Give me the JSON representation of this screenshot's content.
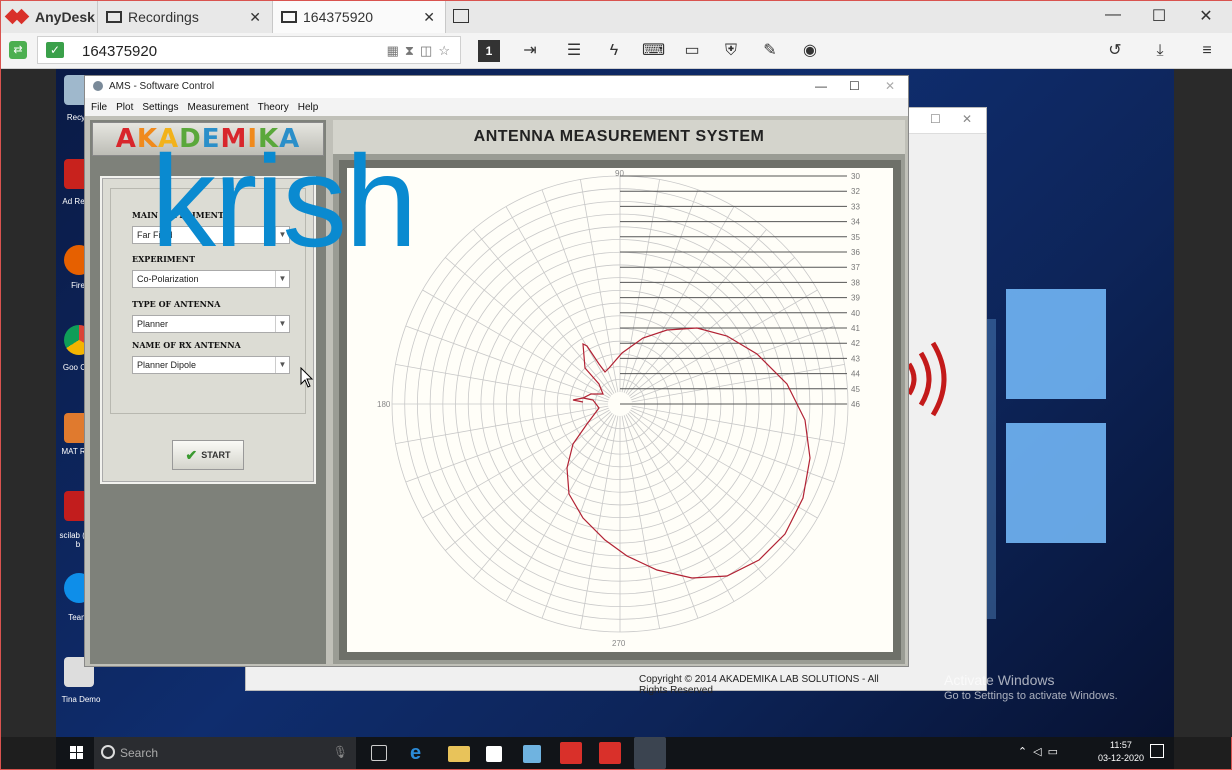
{
  "anydesk": {
    "brand": "AnyDesk",
    "tabs": [
      {
        "label": "Recordings"
      },
      {
        "label": "164375920"
      }
    ],
    "tab_close": "✕",
    "window_controls": {
      "minimize": "—",
      "maximize": "☐",
      "close": "✕"
    },
    "address": "164375920"
  },
  "ams": {
    "title": "AMS - Software Control",
    "title_controls": {
      "minimize": "—",
      "maximize": "☐",
      "close": "✕"
    },
    "menu": [
      "File",
      "Plot",
      "Settings",
      "Measurement",
      "Theory",
      "Help"
    ],
    "logo": "AKADEMIKA",
    "header": "ANTENNA MEASUREMENT SYSTEM",
    "fields": [
      {
        "label": "MAIN EXPERIMENT",
        "value": "Far Field"
      },
      {
        "label": "EXPERIMENT",
        "value": "Co-Polarization"
      },
      {
        "label": "TYPE OF ANTENNA",
        "value": "Planner"
      },
      {
        "label": "NAME OF RX ANTENNA",
        "value": "Planner Dipole"
      }
    ],
    "start_label": "START",
    "copyright": "Copyright © 2014 AKADEMIKA LAB SOLUTIONS - All Rights Reserved"
  },
  "polar_plot": {
    "angle_labels": {
      "top": "90",
      "left": "180",
      "bottom": "270"
    },
    "rings": [
      30,
      32,
      33,
      34,
      35,
      36,
      37,
      38,
      39,
      40,
      41,
      42,
      43,
      44,
      45,
      46
    ],
    "trace_color": "#b22234"
  },
  "watermark": "krish",
  "desktop": {
    "activate_title": "Activate Windows",
    "activate_sub": "Go to Settings to activate Windows.",
    "icons": [
      "Recycle",
      "Adobe Reader",
      "Firefox",
      "Google Chrome",
      "MATLAB R20",
      "scilab (64-b",
      "TeamViewer",
      "Tina Demo"
    ],
    "icon_labels": [
      "Recyc",
      "Ad\nRead",
      "Fire",
      "Goo\nChr",
      "MAT\nR20",
      "scilab\n(64-b",
      "Team",
      "Tina Demo"
    ]
  },
  "taskbar": {
    "search_placeholder": "Search",
    "time": "11:57",
    "date": "03-12-2020"
  }
}
